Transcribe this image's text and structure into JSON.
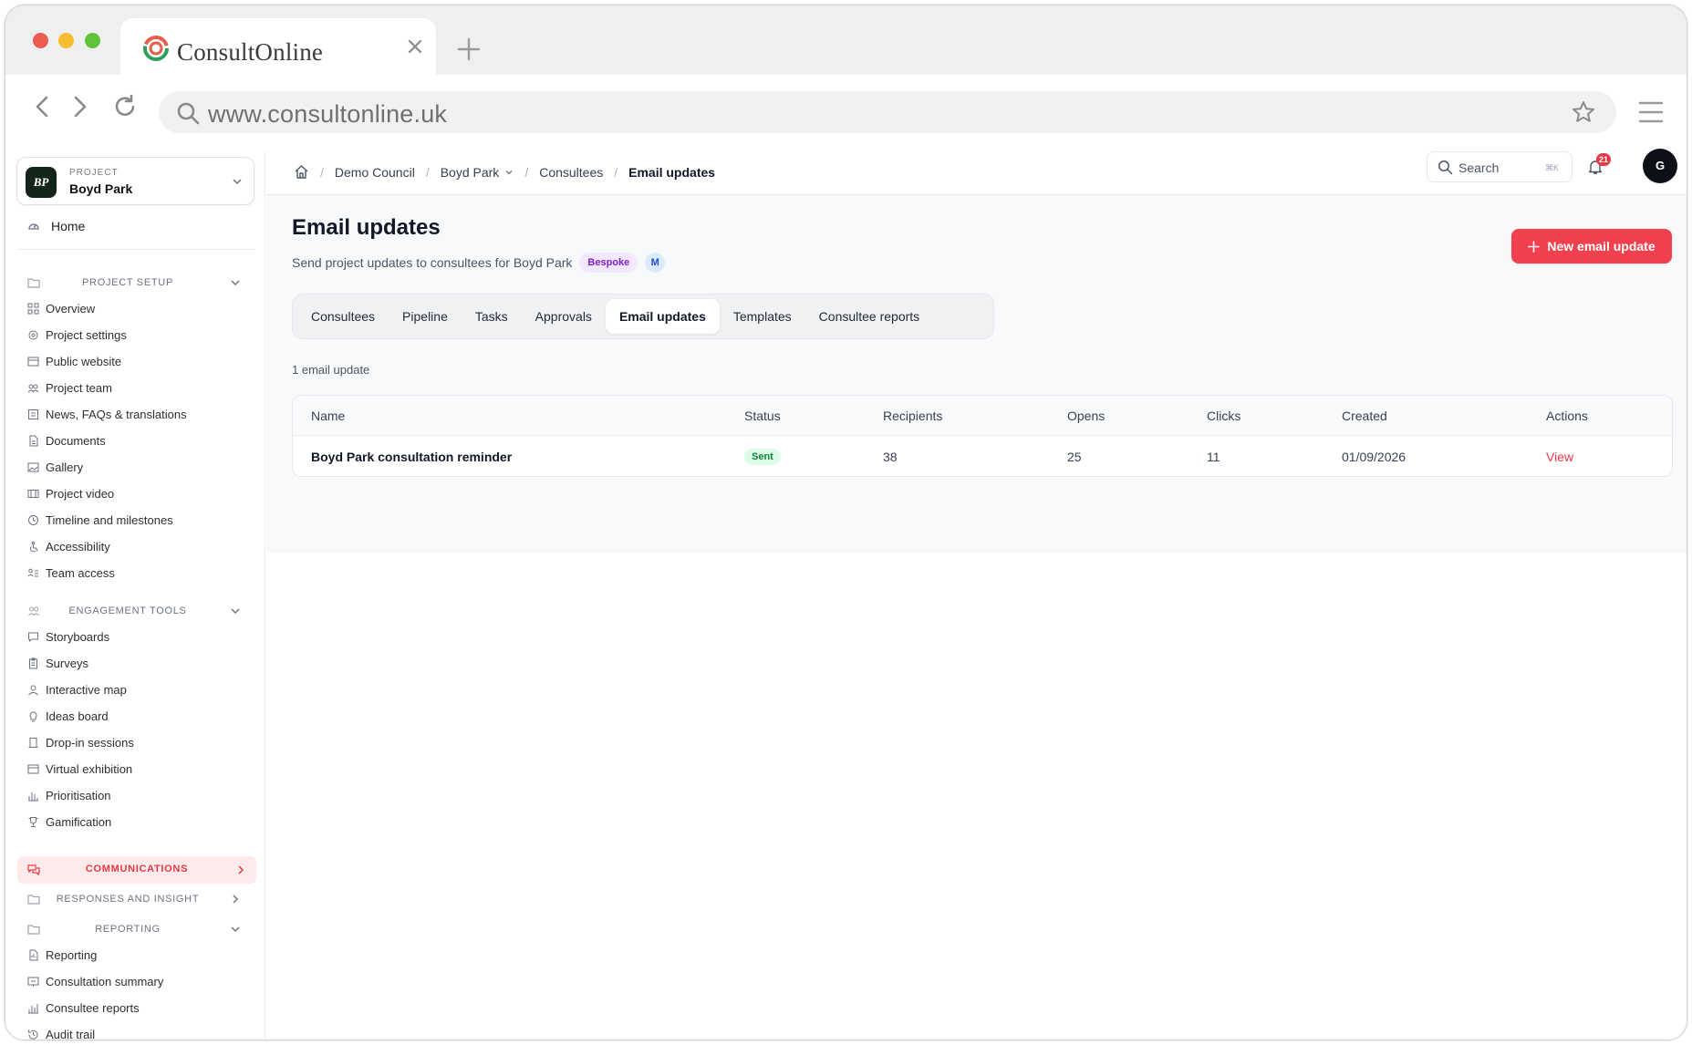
{
  "browser": {
    "tab_title": "ConsultOnline",
    "url": "www.consultonline.uk",
    "icons": [
      "close-icon",
      "plus-icon",
      "back-icon",
      "forward-icon",
      "reload-icon",
      "search-icon",
      "star-icon",
      "menu-icon"
    ]
  },
  "sidebar": {
    "project": {
      "label": "PROJECT",
      "initials": "BP",
      "name": "Boyd Park"
    },
    "home": "Home",
    "sections": {
      "project_setup": {
        "title": "PROJECT SETUP",
        "items": [
          "Overview",
          "Project settings",
          "Public website",
          "Project team",
          "News, FAQs & translations",
          "Documents",
          "Gallery",
          "Project video",
          "Timeline and milestones",
          "Accessibility",
          "Team access"
        ]
      },
      "engagement_tools": {
        "title": "ENGAGEMENT TOOLS",
        "items": [
          "Storyboards",
          "Surveys",
          "Interactive map",
          "Ideas board",
          "Drop-in sessions",
          "Virtual exhibition",
          "Prioritisation",
          "Gamification"
        ]
      },
      "communications": {
        "title": "COMMUNICATIONS"
      },
      "responses": {
        "title": "RESPONSES AND INSIGHT"
      },
      "reporting": {
        "title": "REPORTING",
        "items": [
          "Reporting",
          "Consultation summary",
          "Consultee reports",
          "Audit trail"
        ]
      }
    }
  },
  "topbar": {
    "breadcrumbs": [
      "Demo Council",
      "Boyd Park",
      "Consultees",
      "Email updates"
    ],
    "search_placeholder": "Search",
    "search_shortcut": "⌘K",
    "notifications_count": "21",
    "user_initial": "G"
  },
  "page": {
    "title": "Email updates",
    "subtitle": "Send project updates to consultees for Boyd Park",
    "badge_bespoke": "Bespoke",
    "badge_m": "M",
    "new_button": "New email update",
    "tabs": [
      "Consultees",
      "Pipeline",
      "Tasks",
      "Approvals",
      "Email updates",
      "Templates",
      "Consultee reports"
    ],
    "active_tab": "Email updates",
    "count_text": "1 email update"
  },
  "table": {
    "headers": [
      "Name",
      "Status",
      "Recipients",
      "Opens",
      "Clicks",
      "Created",
      "Actions"
    ],
    "rows": [
      {
        "name": "Boyd Park consultation reminder",
        "status": "Sent",
        "recipients": "38",
        "opens": "25",
        "clicks": "11",
        "created": "01/09/2026",
        "action": "View"
      }
    ]
  },
  "colors": {
    "accent": "#f2414e",
    "brand_dark": "#13251a",
    "status_sent": "#15803d"
  }
}
